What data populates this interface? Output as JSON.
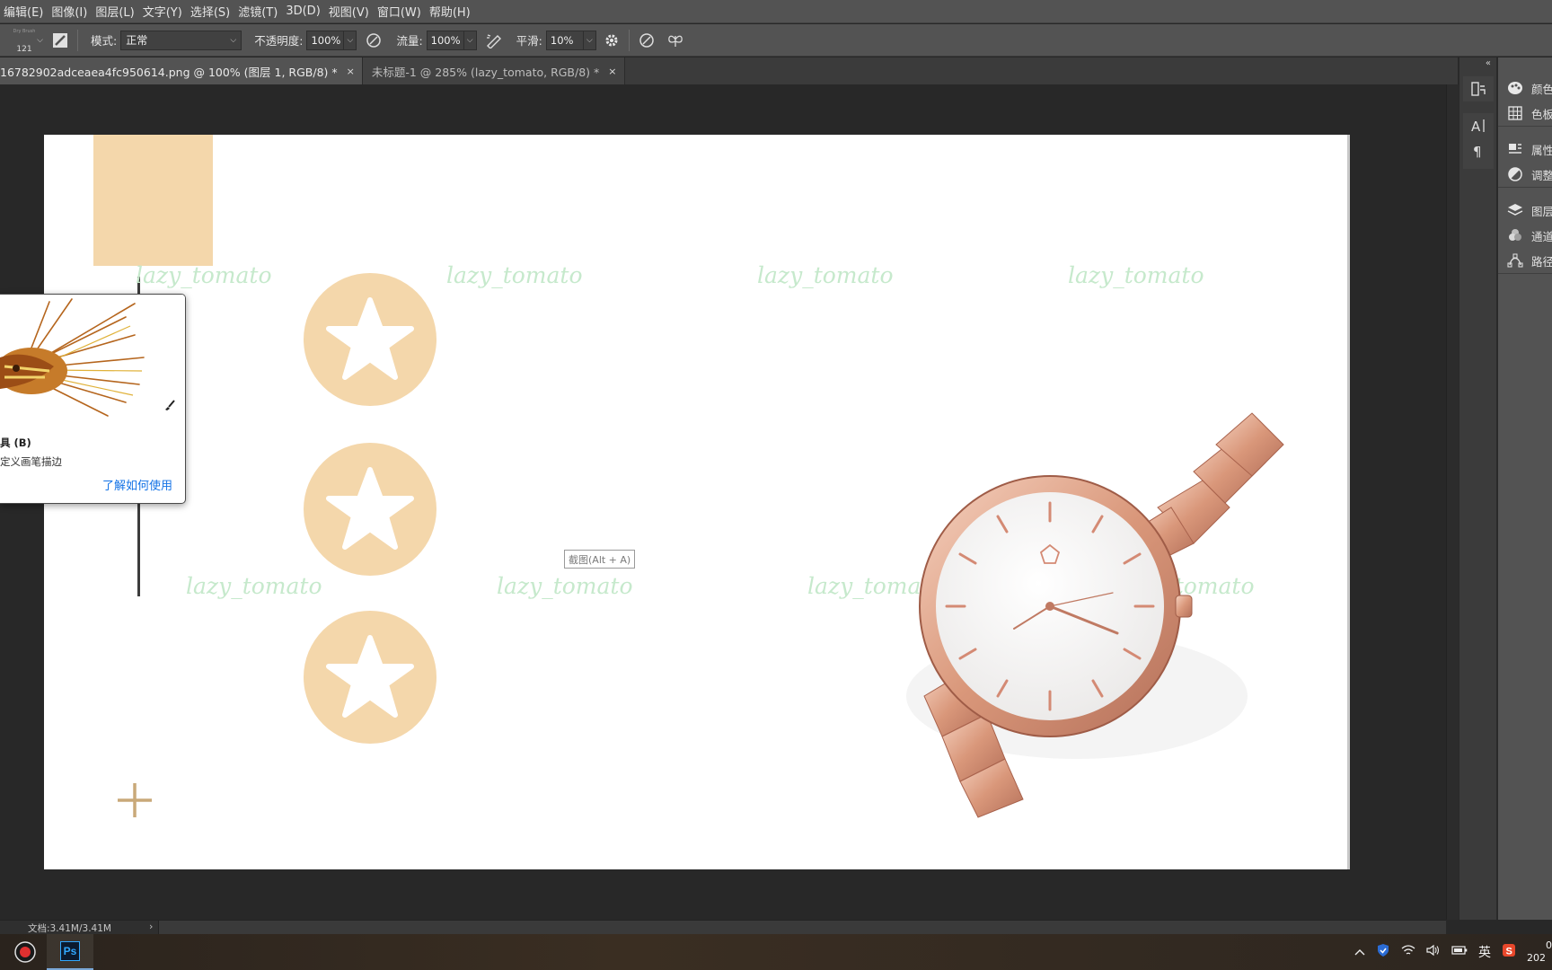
{
  "menu": [
    "编辑(E)",
    "图像(I)",
    "图层(L)",
    "文字(Y)",
    "选择(S)",
    "滤镜(T)",
    "3D(D)",
    "视图(V)",
    "窗口(W)",
    "帮助(H)"
  ],
  "options": {
    "brush_size": "121",
    "brush_name": "Dry Brush",
    "mode_label": "模式:",
    "mode_value": "正常",
    "opacity_label": "不透明度:",
    "opacity_value": "100%",
    "flow_label": "流量:",
    "flow_value": "100%",
    "smoothing_label": "平滑:",
    "smoothing_value": "10%"
  },
  "tabs": [
    {
      "label": "16782902adceaea4fc950614.png @ 100% (图层 1, RGB/8) *",
      "close": "×"
    },
    {
      "label": "未标题-1 @ 285% (lazy_tomato, RGB/8) *",
      "close": "×"
    }
  ],
  "canvas": {
    "watermark": "lazy_tomato",
    "screenshot_tip": "截图(Alt + A)"
  },
  "tooltip": {
    "title": "具 (B)",
    "description": "定义画笔描边",
    "link": "了解如何使用"
  },
  "status": {
    "doc": "文档:3.41M/3.41M",
    "chevron": "›"
  },
  "panels": {
    "collapse": "«",
    "groups": [
      [
        "颜色",
        "色板"
      ],
      [
        "属性",
        "调整"
      ],
      [
        "图层",
        "通道",
        "路径"
      ]
    ]
  },
  "taskbar": {
    "ps_label": "Ps",
    "ime": "英",
    "clock_time": "0",
    "clock_date": "202"
  }
}
